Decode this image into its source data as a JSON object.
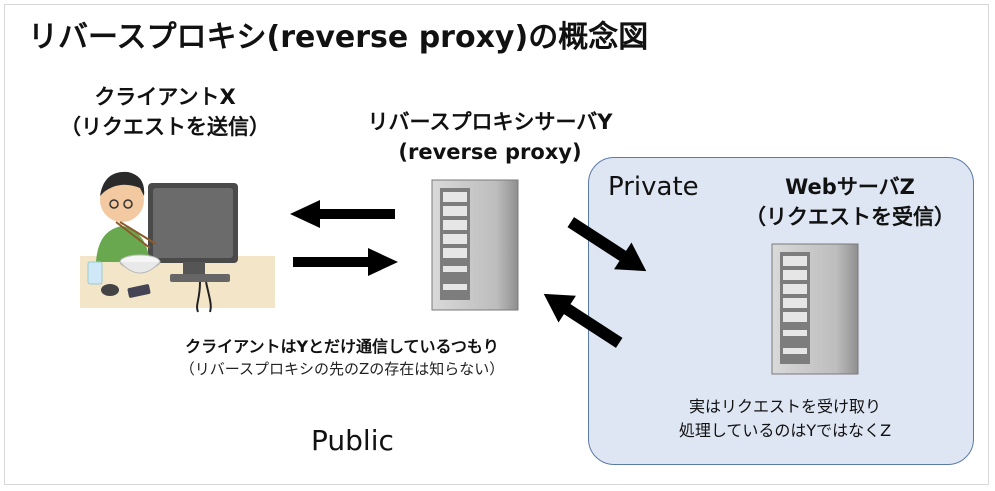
{
  "title": "リバースプロキシ(reverse proxy)の概念図",
  "client": {
    "name": "クライアントX",
    "role": "（リクエストを送信）"
  },
  "proxy": {
    "name": "リバースプロキシサーバY",
    "role": "(reverse proxy)"
  },
  "web_server": {
    "name": "WebサーバZ",
    "role": "（リクエストを受信）"
  },
  "zones": {
    "private": "Private",
    "public": "Public"
  },
  "notes": {
    "client_main": "クライアントはYとだけ通信しているつもり",
    "client_sub": "（リバースプロキシの先のZの存在は知らない）",
    "web_line1": "実はリクエストを受け取り",
    "web_line2": "処理しているのはYではなくZ"
  },
  "colors": {
    "private_fill": "#dfe6f3",
    "private_border": "#5a7aa8",
    "arrow": "#000000",
    "server_body": "#8c8c8c"
  }
}
